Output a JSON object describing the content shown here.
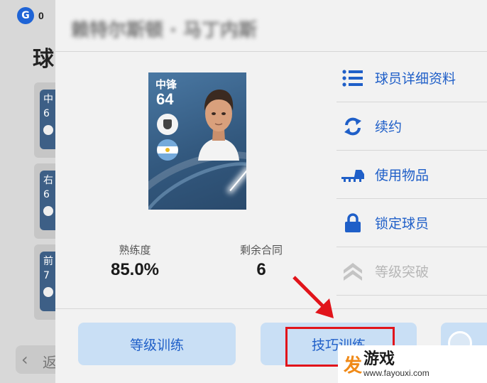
{
  "header": {
    "currency_amount": "0",
    "currency_icon": "g-coin-icon"
  },
  "background": {
    "title": "球",
    "cards": [
      {
        "text_line1": "中",
        "text_line2": "6"
      },
      {
        "text_line1": "右",
        "text_line2": "6"
      },
      {
        "text_line1": "前",
        "text_line2": "7"
      }
    ],
    "back_label": "返"
  },
  "player": {
    "name": "赖特尔斯顿 · 马丁内斯",
    "position": "中锋",
    "rating": "64",
    "nationality_flag": "argentina-flag-icon"
  },
  "stats": {
    "proficiency_label": "熟练度",
    "proficiency_value": "85.0%",
    "contract_label": "剩余合同",
    "contract_value": "6"
  },
  "menu": [
    {
      "label": "球员详细资料",
      "icon": "list-icon",
      "enabled": true
    },
    {
      "label": "续约",
      "icon": "refresh-icon",
      "enabled": true
    },
    {
      "label": "使用物品",
      "icon": "boot-icon",
      "enabled": true
    },
    {
      "label": "锁定球员",
      "icon": "lock-icon",
      "enabled": true
    },
    {
      "label": "等级突破",
      "icon": "chevron-up-icon",
      "enabled": false
    }
  ],
  "buttons": {
    "level_training": "等级训练",
    "skill_training": "技巧训练"
  },
  "watermark": {
    "logo": "发",
    "name": "游戏",
    "url": "www.fayouxi.com"
  },
  "colors": {
    "accent": "#1f5fc8",
    "button_bg": "#c9dff5",
    "highlight": "#e1141b",
    "disabled": "#b7b7b7"
  }
}
